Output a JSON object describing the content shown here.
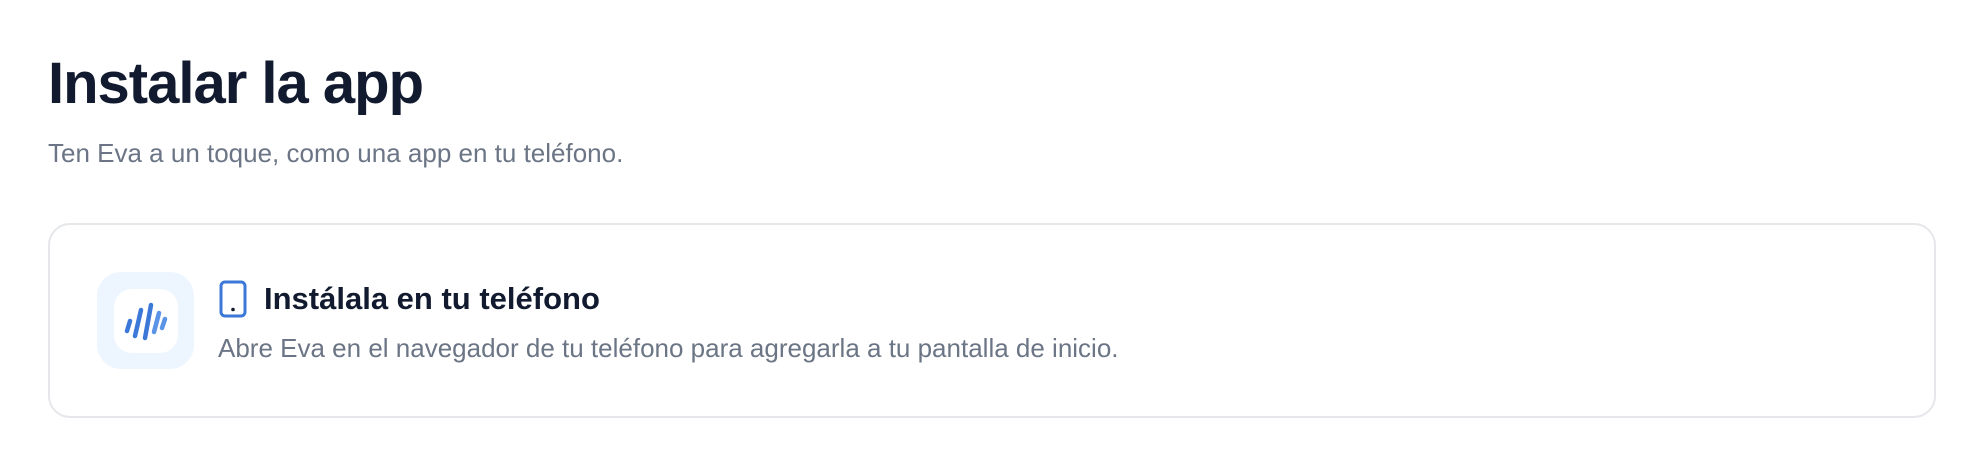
{
  "header": {
    "title": "Instalar la app",
    "subtitle": "Ten Eva a un toque, como una app en tu teléfono."
  },
  "install_card": {
    "app_icon": "eva-soundwave-icon",
    "title_icon": "smartphone-icon",
    "title": "Instálala en tu teléfono",
    "description": "Abre Eva en el navegador de tu teléfono para agregarla a tu pantalla de inicio."
  },
  "colors": {
    "accent": "#3b78d8",
    "accent_light": "#5b93e6",
    "tile_background": "#edf5ff",
    "heading": "#111a2e",
    "muted_text": "#6b7585",
    "border": "#e5e7eb"
  }
}
